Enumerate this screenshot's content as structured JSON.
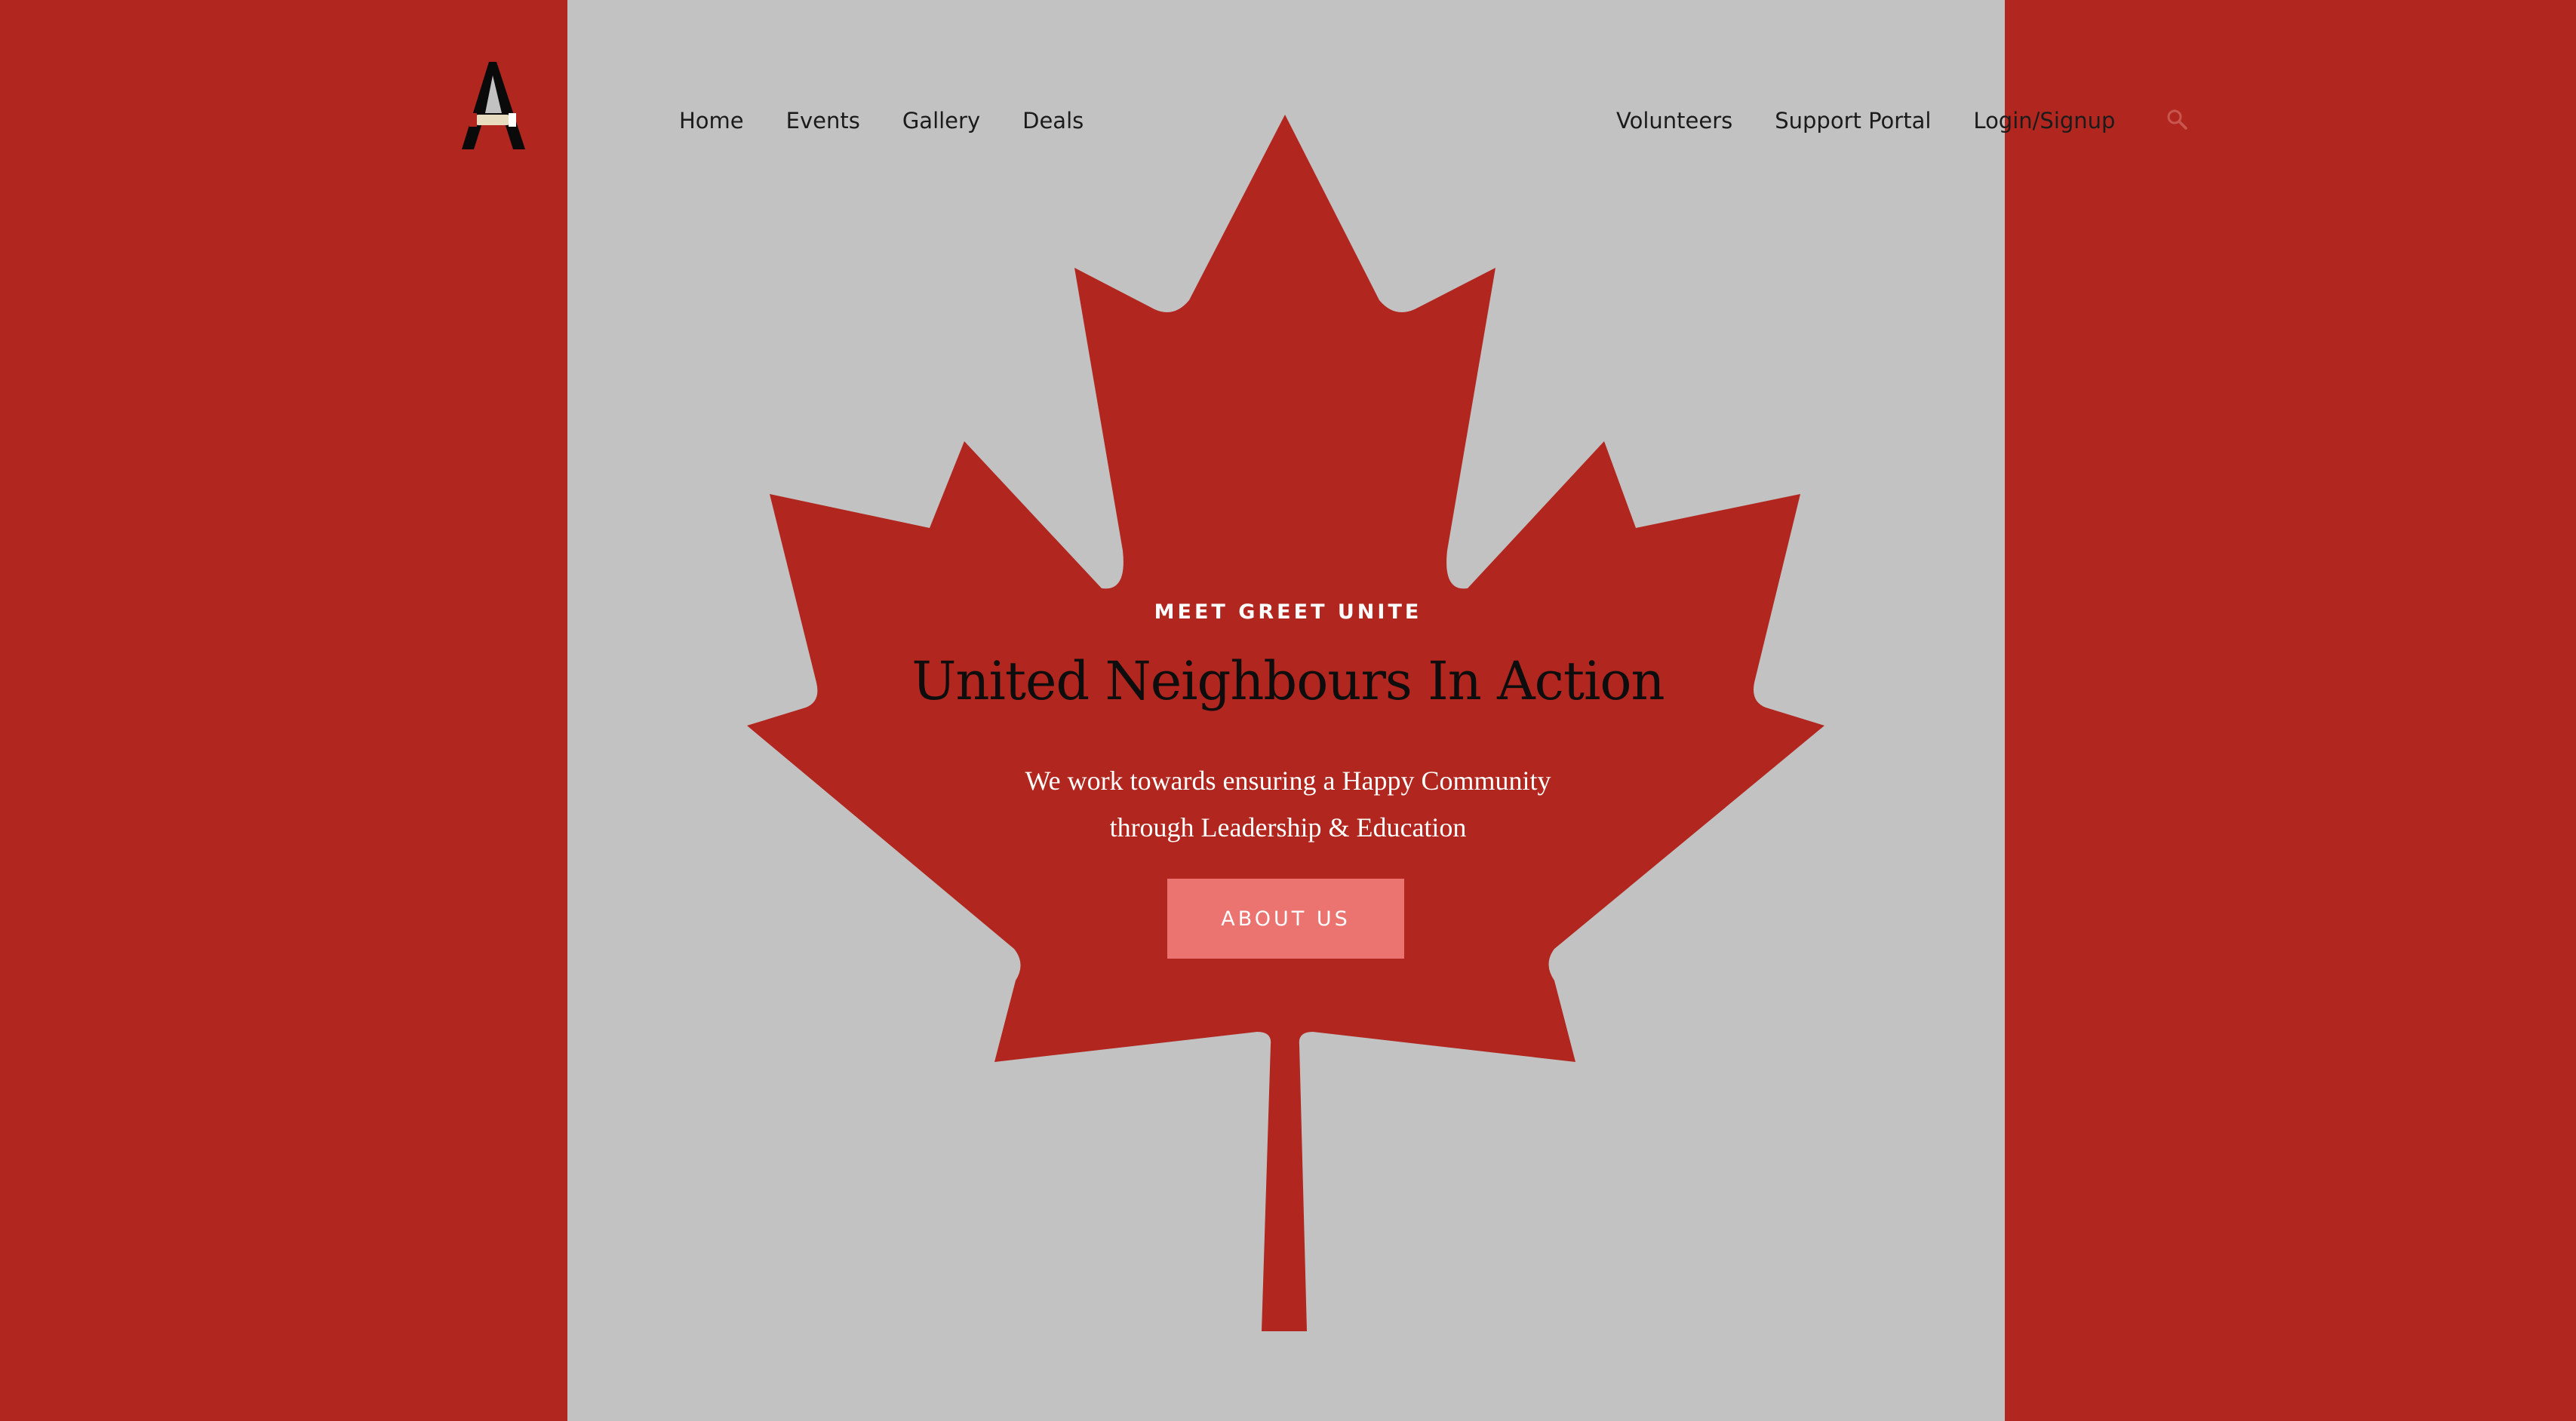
{
  "colors": {
    "flag_red": "#b1261e",
    "flag_white": "#c2c2c2",
    "button_bg": "#ec7470",
    "nav_text": "#1b1b1b"
  },
  "logo": {
    "letter": "A",
    "icon": "handshake-icon"
  },
  "nav": {
    "left_items": [
      "Home",
      "Events",
      "Gallery",
      "Deals"
    ],
    "right_items": [
      "Volunteers",
      "Support Portal",
      "Login/Signup"
    ],
    "search_icon": "search-icon"
  },
  "hero": {
    "eyebrow": "MEET GREET UNITE",
    "headline": "United Neighbours In Action",
    "subtext_line1": "We work towards ensuring a Happy Community",
    "subtext_line2": "through Leadership & Education",
    "cta_label": "ABOUT US"
  }
}
